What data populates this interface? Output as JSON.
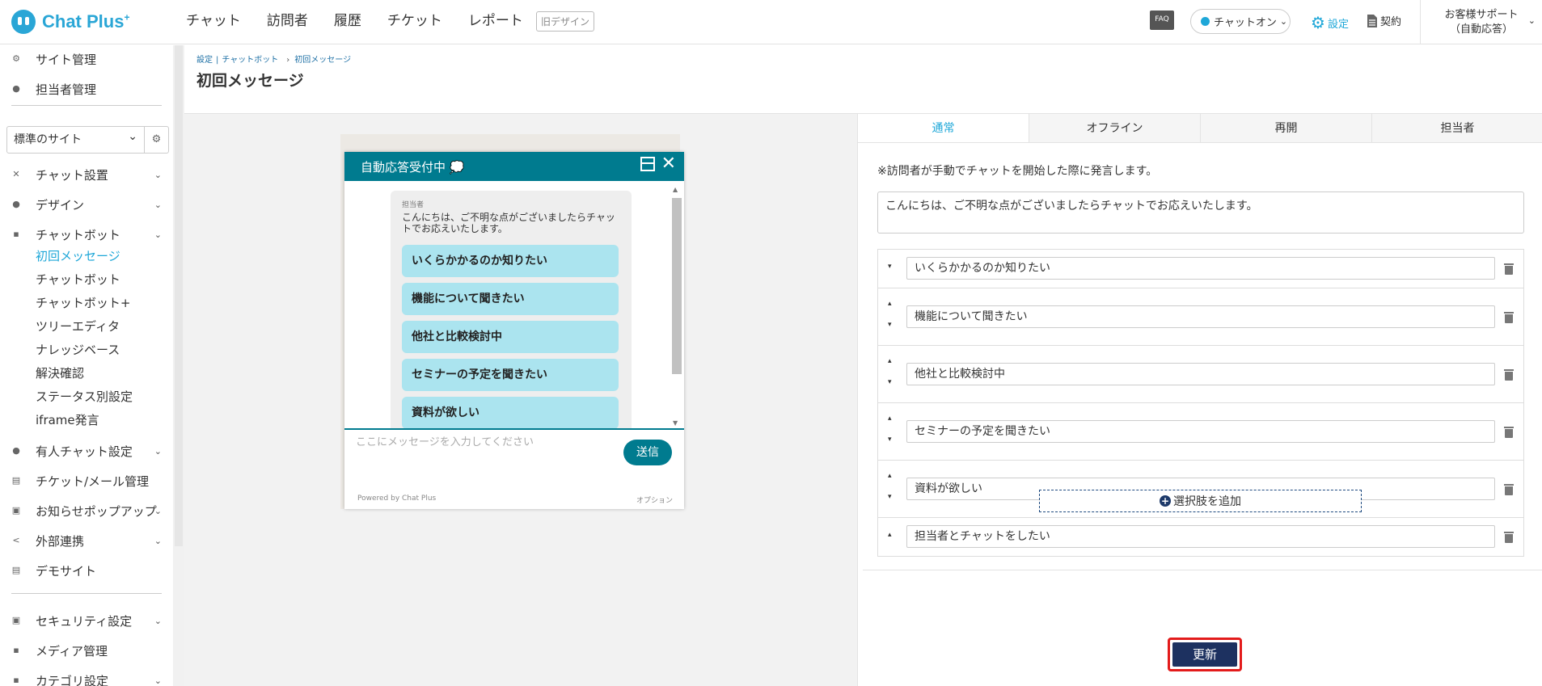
{
  "app": {
    "logo_text": "Chat Plus",
    "logo_sup": "+"
  },
  "topnav": {
    "items": [
      "チャット",
      "訪問者",
      "履歴",
      "チケット",
      "レポート"
    ],
    "old_design": "旧デザイン"
  },
  "header_right": {
    "faq": "FAQ",
    "chat_status": "チャットオン",
    "settings": "設定",
    "contract": "契約",
    "support_line1": "お客様サポート",
    "support_line2": "（自動応答）"
  },
  "sidebar": {
    "top_items": [
      "サイト管理",
      "担当者管理"
    ],
    "site_select": "標準のサイト",
    "items": [
      {
        "label": "チャット設置"
      },
      {
        "label": "デザイン"
      },
      {
        "label": "チャットボット"
      },
      {
        "label": "有人チャット設定"
      },
      {
        "label": "チケット/メール管理"
      },
      {
        "label": "お知らせポップアップ"
      },
      {
        "label": "外部連携"
      },
      {
        "label": "デモサイト"
      },
      {
        "label": "セキュリティ設定"
      },
      {
        "label": "メディア管理"
      },
      {
        "label": "カテゴリ設定"
      }
    ],
    "chatbot_sub": [
      "初回メッセージ",
      "チャットボット",
      "チャットボット+",
      "ツリーエディタ",
      "ナレッジベース",
      "解決確認",
      "ステータス別設定",
      "iframe発言"
    ]
  },
  "breadcrumb": {
    "a": "設定",
    "sep1": "|",
    "b": "チャットボット",
    "sep2": "›",
    "c": "初回メッセージ"
  },
  "page_title": "初回メッセージ",
  "preview": {
    "header": "自動応答受付中 💭",
    "sender": "担当者",
    "message": "こんにちは、ご不明な点がございましたらチャットでお応えいたします。",
    "options": [
      "いくらかかるのか知りたい",
      "機能について聞きたい",
      "他社と比較検討中",
      "セミナーの予定を聞きたい",
      "資料が欲しい"
    ],
    "input_placeholder": "ここにメッセージを入力してください",
    "send": "送信",
    "powered": "Powered by Chat Plus",
    "option_link": "オプション"
  },
  "tabs": [
    {
      "label": "通常"
    },
    {
      "label": "オフライン"
    },
    {
      "label": "再開"
    },
    {
      "label": "担当者"
    }
  ],
  "form": {
    "note": "※訪問者が手動でチャットを開始した際に発言します。",
    "message": "こんにちは、ご不明な点がございましたらチャットでお応えいたします。",
    "choices": [
      "いくらかかるのか知りたい",
      "機能について聞きたい",
      "他社と比較検討中",
      "セミナーの予定を聞きたい",
      "資料が欲しい",
      "担当者とチャットをしたい"
    ],
    "add_choice": "選択肢を追加",
    "update": "更新"
  }
}
